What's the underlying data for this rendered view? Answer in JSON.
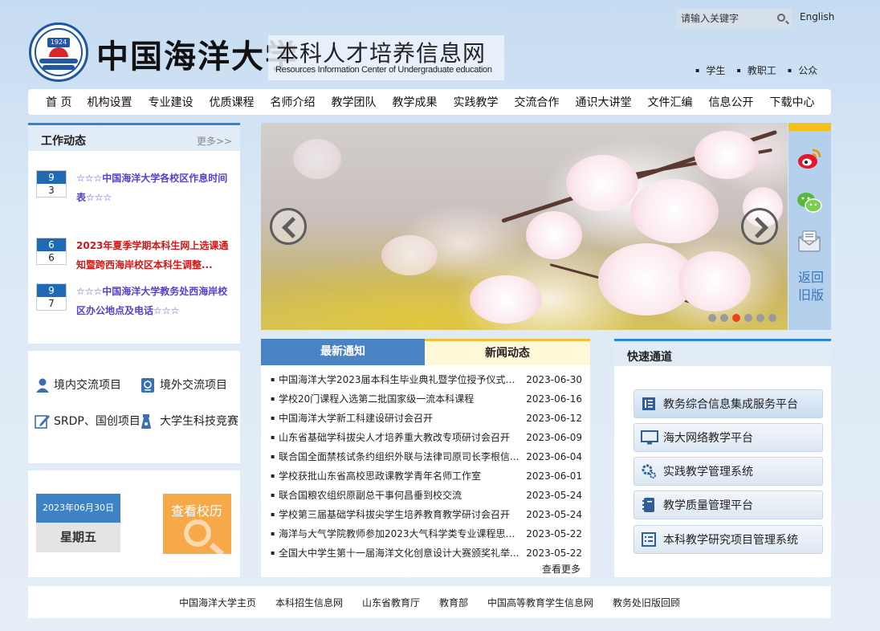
{
  "header": {
    "brand_cn": "中国海洋大学",
    "logo_year": "1924",
    "site_title": "本科人才培养信息网",
    "site_subtitle": "Resources Information Center of Undergraduate education",
    "search_placeholder": "请输入关键字",
    "lang": "English",
    "roles": [
      "学生",
      "教职工",
      "公众"
    ]
  },
  "nav": [
    "首 页",
    "机构设置",
    "专业建设",
    "优质课程",
    "名师介绍",
    "教学团队",
    "教学成果",
    "实践教学",
    "交流合作",
    "通识大讲堂",
    "文件汇编",
    "信息公开",
    "下载中心"
  ],
  "work": {
    "title": "工作动态",
    "more": "更多>>",
    "items": [
      {
        "month": "9",
        "day": "3",
        "text": "☆☆☆中国海洋大学各校区作息时间表☆☆☆"
      },
      {
        "month": "6",
        "day": "6",
        "text": "2023年夏季学期本科生网上选课通知暨跨西海岸校区本科生调整..."
      },
      {
        "month": "9",
        "day": "7",
        "text": "☆☆☆中国海洋大学教务处西海岸校区办公地点及电话☆☆☆"
      }
    ]
  },
  "links": [
    "境内交流项目",
    "境外交流项目",
    "SRDP、国创项目",
    "大学生科技竞赛"
  ],
  "calendar": {
    "date": "2023年06月30日",
    "weekday": "星期五",
    "history": "查看校历"
  },
  "side": {
    "old": "返回旧版"
  },
  "news": {
    "tabs": [
      "最新通知",
      "新闻动态"
    ],
    "more": "查看更多",
    "items": [
      {
        "title": "中国海洋大学2023届本科生毕业典礼暨学位授予仪式举...",
        "date": "2023-06-30"
      },
      {
        "title": "学校20门课程入选第二批国家级一流本科课程",
        "date": "2023-06-16"
      },
      {
        "title": "中国海洋大学新工科建设研讨会召开",
        "date": "2023-06-12"
      },
      {
        "title": "山东省基础学科拔尖人才培养重大教改专项研讨会召开",
        "date": "2023-06-09"
      },
      {
        "title": "联合国全面禁核试条约组织外联与法律司原司长李根信...",
        "date": "2023-06-04"
      },
      {
        "title": "学校获批山东省高校思政课教学青年名师工作室",
        "date": "2023-06-01"
      },
      {
        "title": "联合国粮农组织原副总干事何昌垂到校交流",
        "date": "2023-05-24"
      },
      {
        "title": "学校第三届基础学科拔尖学生培养教育教学研讨会召开",
        "date": "2023-05-24"
      },
      {
        "title": "海洋与大气学院教师参加2023大气科学类专业课程思政...",
        "date": "2023-05-22"
      },
      {
        "title": "全国大中学生第十一届海洋文化创意设计大赛颁奖礼举...",
        "date": "2023-05-22"
      }
    ]
  },
  "quick": {
    "title": "快速通道",
    "items": [
      "教务综合信息集成服务平台",
      "海大网络教学平台",
      "实践教学管理系统",
      "教学质量管理平台",
      "本科教学研究项目管理系统"
    ]
  },
  "footer": [
    "中国海洋大学主页",
    "本科招生信息网",
    "山东省教育厅",
    "教育部",
    "中国高等教育学生信息网",
    "教务处旧版回顾"
  ],
  "colors": {
    "accent_blue": "#2b86d6",
    "tab_blue": "#4a84c4",
    "highlight_red": "#d01818",
    "purple_link": "#5a3fc9",
    "history_orange": "#f7a94a"
  }
}
